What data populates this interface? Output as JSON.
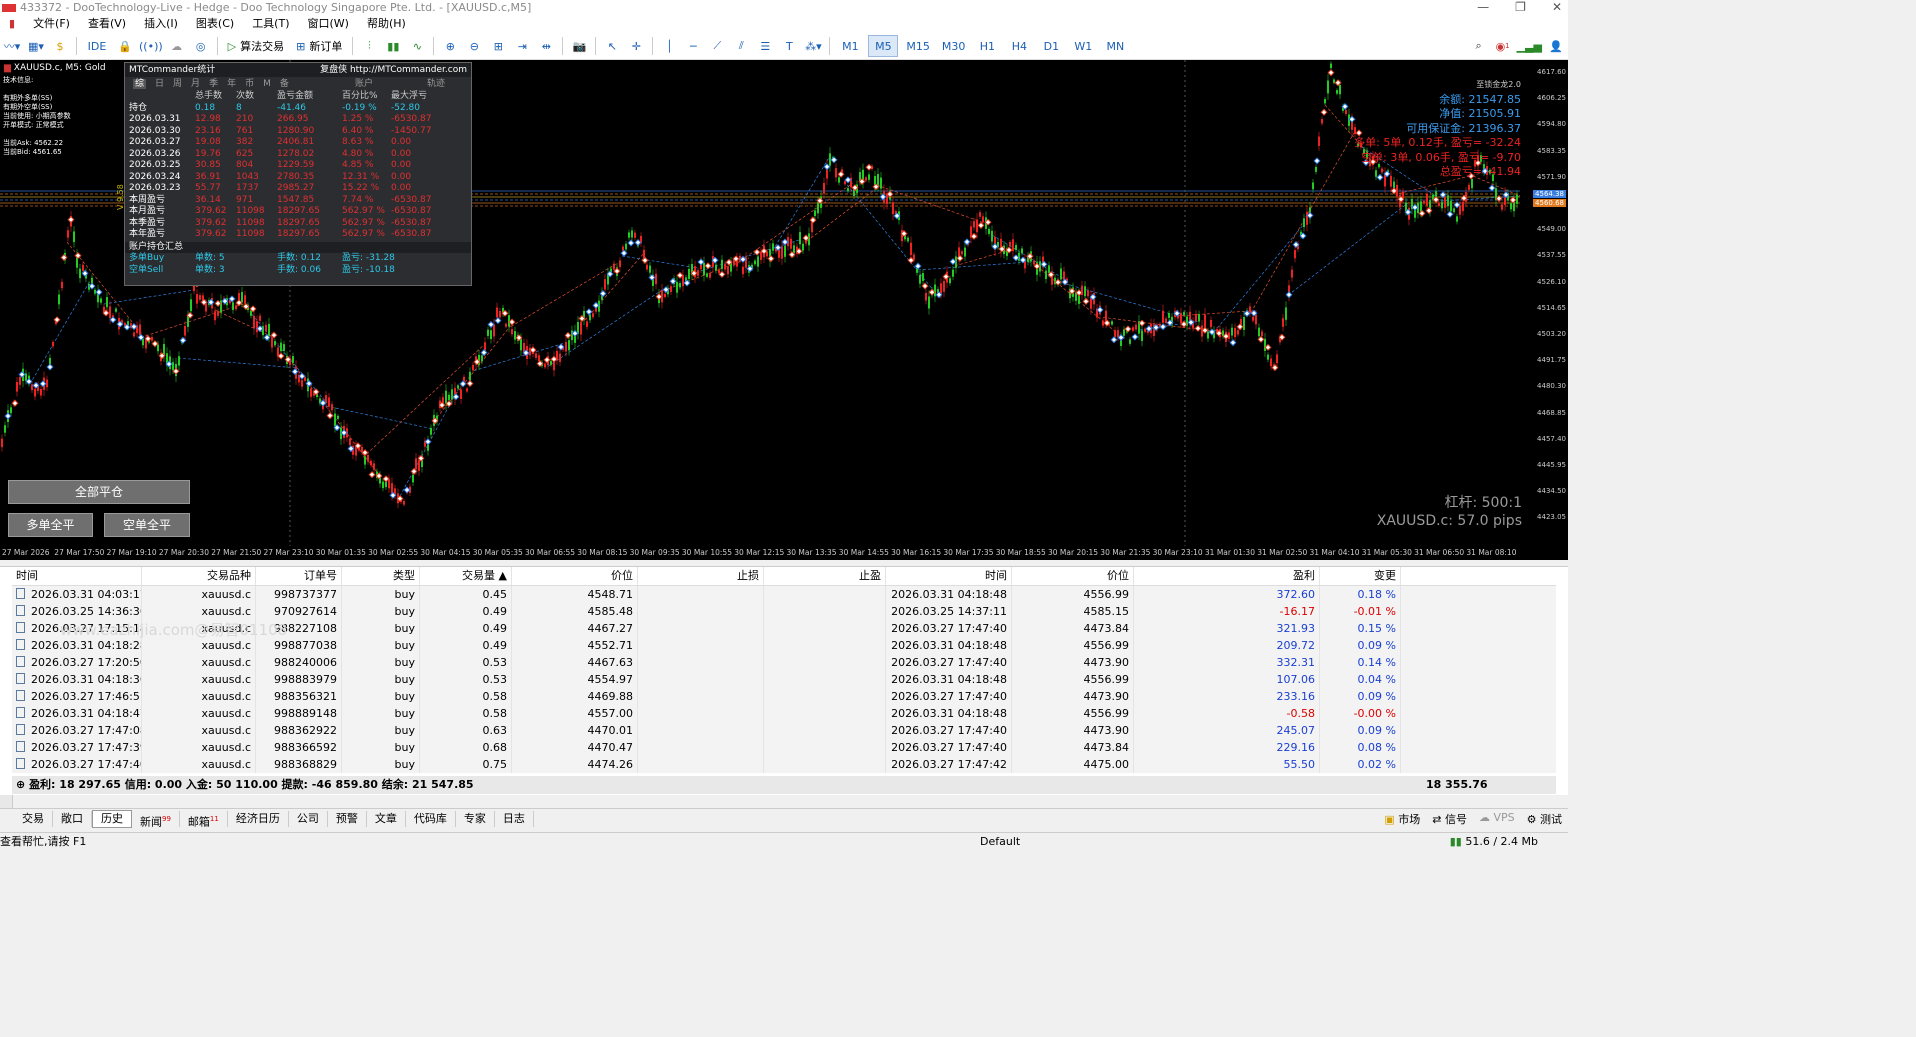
{
  "window": {
    "title": "433372 - DooTechnology-Live - Hedge - Doo Technology Singapore Pte. Ltd. - [XAUUSD.c,M5]"
  },
  "menu": [
    "文件(F)",
    "查看(V)",
    "插入(I)",
    "图表(C)",
    "工具(T)",
    "窗口(W)",
    "帮助(H)"
  ],
  "toolbar": {
    "ide": "IDE",
    "algo": "算法交易",
    "neworder": "新订单",
    "timeframes": [
      "M1",
      "M5",
      "M15",
      "M30",
      "H1",
      "H4",
      "D1",
      "W1",
      "MN"
    ],
    "active_tf": "M5",
    "alerts": "1"
  },
  "chart": {
    "symbol": "XAUUSD.c, M5:  Gold",
    "info_lines": [
      "技术信息:",
      "有期外多单(SS)",
      "有期外空单(SS)",
      "当前使用: 小期高参数",
      "开单模式: 正常模式",
      "当前Ask: 4562.22",
      "当前Bid: 4561.65"
    ],
    "ea_label": "至锁金龙2.0",
    "version": "V 9.58",
    "right_info": {
      "balance": "余额: 21547.85",
      "equity": "净值: 21505.91",
      "free_margin": "可用保证金: 21396.37",
      "long": "多单: 5单, 0.12手, 盈亏= -32.24",
      "short": "空单: 3单, 0.06手, 盈亏= -9.70",
      "total": "总盈亏= -41.94"
    },
    "leverage": "杠杆: 500:1",
    "spread": "XAUUSD.c: 57.0 pips",
    "price_labels": [
      "4564.38",
      "4560.68"
    ],
    "y_ticks": [
      "4617.60",
      "4606.25",
      "4594.80",
      "4583.35",
      "4571.90",
      "4560.45",
      "4549.00",
      "4537.55",
      "4526.10",
      "4514.65",
      "4503.20",
      "4491.75",
      "4480.30",
      "4468.85",
      "4457.40",
      "4445.95",
      "4434.50",
      "4423.05"
    ],
    "x_ticks": [
      "27 Mar 2026",
      "27 Mar 17:50",
      "27 Mar 19:10",
      "27 Mar 20:30",
      "27 Mar 21:50",
      "27 Mar 23:10",
      "30 Mar 01:35",
      "30 Mar 02:55",
      "30 Mar 04:15",
      "30 Mar 05:35",
      "30 Mar 06:55",
      "30 Mar 08:15",
      "30 Mar 09:35",
      "30 Mar 10:55",
      "30 Mar 12:15",
      "30 Mar 13:35",
      "30 Mar 14:55",
      "30 Mar 16:15",
      "30 Mar 17:35",
      "30 Mar 18:55",
      "30 Mar 20:15",
      "30 Mar 21:35",
      "30 Mar 23:10",
      "31 Mar 01:30",
      "31 Mar 02:50",
      "31 Mar 04:10",
      "31 Mar 05:30",
      "31 Mar 06:50",
      "31 Mar 08:10"
    ]
  },
  "stats": {
    "title": "MTCommander统计",
    "link": "复盘侠 http://MTCommander.com",
    "tabs": [
      "综",
      "日",
      "周",
      "月",
      "季",
      "年",
      "币",
      "M",
      "备"
    ],
    "acct": "账户",
    "track": "轨迹",
    "headers": [
      "总手数",
      "次数",
      "盈亏金额",
      "百分比%",
      "最大浮亏"
    ],
    "rows": [
      {
        "label": "持仓",
        "lots": "0.18",
        "count": "8",
        "pnl": "-41.46",
        "pct": "-0.19 %",
        "dd": "-52.80",
        "cls": "cyan"
      },
      {
        "label": "2026.03.31",
        "lots": "12.98",
        "count": "210",
        "pnl": "266.95",
        "pct": "1.25 %",
        "dd": "-6530.87",
        "cls": "red"
      },
      {
        "label": "2026.03.30",
        "lots": "23.16",
        "count": "761",
        "pnl": "1280.90",
        "pct": "6.40 %",
        "dd": "-1450.77",
        "cls": "red"
      },
      {
        "label": "2026.03.27",
        "lots": "19.08",
        "count": "382",
        "pnl": "2406.81",
        "pct": "8.63 %",
        "dd": "0.00",
        "cls": "red"
      },
      {
        "label": "2026.03.26",
        "lots": "19.76",
        "count": "625",
        "pnl": "1278.02",
        "pct": "4.80 %",
        "dd": "0.00",
        "cls": "red"
      },
      {
        "label": "2026.03.25",
        "lots": "30.85",
        "count": "804",
        "pnl": "1229.59",
        "pct": "4.85 %",
        "dd": "0.00",
        "cls": "red"
      },
      {
        "label": "2026.03.24",
        "lots": "36.91",
        "count": "1043",
        "pnl": "2780.35",
        "pct": "12.31 %",
        "dd": "0.00",
        "cls": "red"
      },
      {
        "label": "2026.03.23",
        "lots": "55.77",
        "count": "1737",
        "pnl": "2985.27",
        "pct": "15.22 %",
        "dd": "0.00",
        "cls": "red"
      },
      {
        "label": "本周盈亏",
        "lots": "36.14",
        "count": "971",
        "pnl": "1547.85",
        "pct": "7.74 %",
        "dd": "-6530.87",
        "cls": "red"
      },
      {
        "label": "本月盈亏",
        "lots": "379.62",
        "count": "11098",
        "pnl": "18297.65",
        "pct": "562.97 %",
        "dd": "-6530.87",
        "cls": "red"
      },
      {
        "label": "本季盈亏",
        "lots": "379.62",
        "count": "11098",
        "pnl": "18297.65",
        "pct": "562.97 %",
        "dd": "-6530.87",
        "cls": "red"
      },
      {
        "label": "本年盈亏",
        "lots": "379.62",
        "count": "11098",
        "pnl": "18297.65",
        "pct": "562.97 %",
        "dd": "-6530.87",
        "cls": "red"
      }
    ],
    "summary_title": "账户持仓汇总",
    "buy": {
      "label": "多单Buy",
      "count": "单数: 5",
      "lots": "手数: 0.12",
      "pnl": "盈亏: -31.28"
    },
    "sell": {
      "label": "空单Sell",
      "count": "单数: 3",
      "lots": "手数: 0.06",
      "pnl": "盈亏: -10.18"
    }
  },
  "buttons": {
    "close_all": "全部平仓",
    "close_long": "多单全平",
    "close_short": "空单全平"
  },
  "history": {
    "headers": [
      "时间",
      "交易品种",
      "订单号",
      "类型",
      "交易量 ▲",
      "价位",
      "止损",
      "止盈",
      "时间",
      "价位",
      "盈利",
      "变更"
    ],
    "rows": [
      {
        "t1": "2026.03.31 04:03:17",
        "sym": "xauusd.c",
        "order": "998737377",
        "type": "buy",
        "vol": "0.45",
        "p1": "4548.71",
        "sl": "",
        "tp": "",
        "t2": "2026.03.31 04:18:48",
        "p2": "4556.99",
        "profit": "372.60",
        "chg": "0.18 %",
        "neg": false
      },
      {
        "t1": "2026.03.25 14:36:36",
        "sym": "xauusd.c",
        "order": "970927614",
        "type": "buy",
        "vol": "0.49",
        "p1": "4585.48",
        "sl": "",
        "tp": "",
        "t2": "2026.03.25 14:37:11",
        "p2": "4585.15",
        "profit": "-16.17",
        "chg": "-0.01 %",
        "neg": true
      },
      {
        "t1": "2026.03.27 17:15:18",
        "sym": "xauusd.c",
        "order": "988227108",
        "type": "buy",
        "vol": "0.49",
        "p1": "4467.27",
        "sl": "",
        "tp": "",
        "t2": "2026.03.27 17:47:40",
        "p2": "4473.84",
        "profit": "321.93",
        "chg": "0.15 %",
        "neg": false
      },
      {
        "t1": "2026.03.31 04:18:28",
        "sym": "xauusd.c",
        "order": "998877038",
        "type": "buy",
        "vol": "0.49",
        "p1": "4552.71",
        "sl": "",
        "tp": "",
        "t2": "2026.03.31 04:18:48",
        "p2": "4556.99",
        "profit": "209.72",
        "chg": "0.09 %",
        "neg": false
      },
      {
        "t1": "2026.03.27 17:20:50",
        "sym": "xauusd.c",
        "order": "988240006",
        "type": "buy",
        "vol": "0.53",
        "p1": "4467.63",
        "sl": "",
        "tp": "",
        "t2": "2026.03.27 17:47:40",
        "p2": "4473.90",
        "profit": "332.31",
        "chg": "0.14 %",
        "neg": false
      },
      {
        "t1": "2026.03.31 04:18:36",
        "sym": "xauusd.c",
        "order": "998883979",
        "type": "buy",
        "vol": "0.53",
        "p1": "4554.97",
        "sl": "",
        "tp": "",
        "t2": "2026.03.31 04:18:48",
        "p2": "4556.99",
        "profit": "107.06",
        "chg": "0.04 %",
        "neg": false
      },
      {
        "t1": "2026.03.27 17:46:51",
        "sym": "xauusd.c",
        "order": "988356321",
        "type": "buy",
        "vol": "0.58",
        "p1": "4469.88",
        "sl": "",
        "tp": "",
        "t2": "2026.03.27 17:47:40",
        "p2": "4473.90",
        "profit": "233.16",
        "chg": "0.09 %",
        "neg": false
      },
      {
        "t1": "2026.03.31 04:18:47",
        "sym": "xauusd.c",
        "order": "998889148",
        "type": "buy",
        "vol": "0.58",
        "p1": "4557.00",
        "sl": "",
        "tp": "",
        "t2": "2026.03.31 04:18:48",
        "p2": "4556.99",
        "profit": "-0.58",
        "chg": "-0.00 %",
        "neg": true
      },
      {
        "t1": "2026.03.27 17:47:08",
        "sym": "xauusd.c",
        "order": "988362922",
        "type": "buy",
        "vol": "0.63",
        "p1": "4470.01",
        "sl": "",
        "tp": "",
        "t2": "2026.03.27 17:47:40",
        "p2": "4473.90",
        "profit": "245.07",
        "chg": "0.09 %",
        "neg": false
      },
      {
        "t1": "2026.03.27 17:47:39",
        "sym": "xauusd.c",
        "order": "988366592",
        "type": "buy",
        "vol": "0.68",
        "p1": "4470.47",
        "sl": "",
        "tp": "",
        "t2": "2026.03.27 17:47:40",
        "p2": "4473.84",
        "profit": "229.16",
        "chg": "0.08 %",
        "neg": false
      },
      {
        "t1": "2026.03.27 17:47:40",
        "sym": "xauusd.c",
        "order": "988368829",
        "type": "buy",
        "vol": "0.75",
        "p1": "4474.26",
        "sl": "",
        "tp": "",
        "t2": "2026.03.27 17:47:42",
        "p2": "4475.00",
        "profit": "55.50",
        "chg": "0.02 %",
        "neg": false
      }
    ],
    "summary": "盈利: 18 297.65  信用: 0.00  入金: 50 110.00  提款: -46 859.80  结余: 21 547.85",
    "total": "18 355.76",
    "watermark": "www.eazhijia.com@易智01108"
  },
  "bottom_tabs": [
    {
      "label": "交易",
      "badge": ""
    },
    {
      "label": "敞口",
      "badge": ""
    },
    {
      "label": "历史",
      "badge": ""
    },
    {
      "label": "新闻",
      "badge": "99"
    },
    {
      "label": "邮箱",
      "badge": "11"
    },
    {
      "label": "经济日历",
      "badge": ""
    },
    {
      "label": "公司",
      "badge": ""
    },
    {
      "label": "预警",
      "badge": ""
    },
    {
      "label": "文章",
      "badge": ""
    },
    {
      "label": "代码库",
      "badge": ""
    },
    {
      "label": "专家",
      "badge": ""
    },
    {
      "label": "日志",
      "badge": ""
    }
  ],
  "right_tabs": [
    "市场",
    "信号",
    "VPS",
    "测试"
  ],
  "status": {
    "help": "查看帮忙,请按 F1",
    "profile": "Default",
    "memory": "51.6 / 2.4 Mb"
  }
}
